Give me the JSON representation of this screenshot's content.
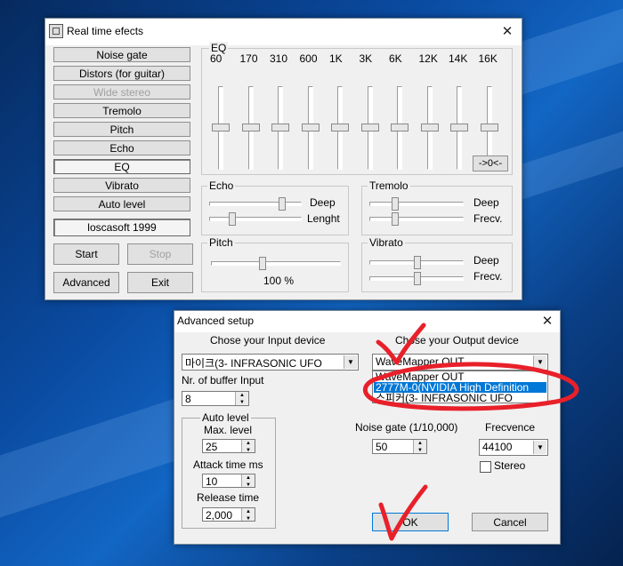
{
  "main_window": {
    "title": "Real time efects",
    "effects": [
      {
        "label": "Noise gate",
        "state": "normal"
      },
      {
        "label": "Distors (for guitar)",
        "state": "normal"
      },
      {
        "label": "Wide stereo",
        "state": "disabled"
      },
      {
        "label": "Tremolo",
        "state": "normal"
      },
      {
        "label": "Pitch",
        "state": "normal"
      },
      {
        "label": "Echo",
        "state": "normal"
      },
      {
        "label": "EQ",
        "state": "pressed"
      },
      {
        "label": "Vibrato",
        "state": "normal"
      },
      {
        "label": "Auto level",
        "state": "normal"
      }
    ],
    "copyright": "loscasoft 1999",
    "start_label": "Start",
    "stop_label": "Stop",
    "advanced_label": "Advanced",
    "exit_label": "Exit",
    "eq": {
      "title": "EQ",
      "bands": [
        "60",
        "170",
        "310",
        "600",
        "1K",
        "3K",
        "6K",
        "12K",
        "14K",
        "16K"
      ],
      "reset_label": "->0<-"
    },
    "echo": {
      "title": "Echo",
      "deep_label": "Deep",
      "length_label": "Lenght"
    },
    "tremolo": {
      "title": "Tremolo",
      "deep_label": "Deep",
      "freq_label": "Frecv."
    },
    "pitch": {
      "title": "Pitch",
      "value": "100 %"
    },
    "vibrato": {
      "title": "Vibrato",
      "deep_label": "Deep",
      "freq_label": "Frecv."
    }
  },
  "advanced_window": {
    "title": "Advanced setup",
    "input_heading": "Chose your Input device",
    "output_heading": "Chose your Output device",
    "input_device": "마이크(3- INFRASONIC UFO",
    "output_device": "WaveMapper OUT",
    "output_options": [
      "WaveMapper OUT",
      "2777M-0(NVIDIA High Definition",
      "스피커(3- INFRASONIC UFO"
    ],
    "buffer_label": "Nr. of buffer Input",
    "buffer_value": "8",
    "auto_level": {
      "title": "Auto level",
      "max_label": "Max. level",
      "max_value": "25",
      "attack_label": "Attack time ms",
      "attack_value": "10",
      "release_label": "Release time",
      "release_value": "2,000"
    },
    "noise_gate_label": "Noise gate (1/10,000)",
    "noise_gate_value": "50",
    "frequency_label": "Frecvence",
    "frequency_value": "44100",
    "stereo_label": "Stereo",
    "ok_label": "OK",
    "cancel_label": "Cancel"
  },
  "colors": {
    "annotation": "#e8202a",
    "selection": "#0078d7"
  }
}
